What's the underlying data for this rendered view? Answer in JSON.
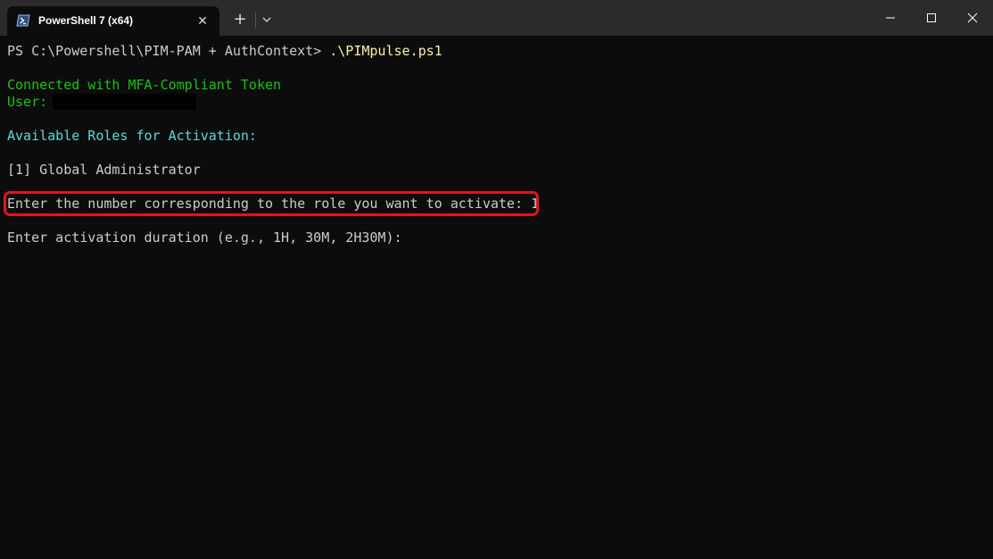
{
  "window": {
    "tab_title": "PowerShell 7 (x64)",
    "tab_icon": "powershell-icon",
    "new_tab_label": "+",
    "close_tab_label": "✕"
  },
  "terminal": {
    "prompt": "PS C:\\Powershell\\PIM-PAM + AuthContext> ",
    "command": ".\\PIMpulse.ps1",
    "connected": "Connected with MFA-Compliant Token",
    "user_label": "User:",
    "roles_header": "Available Roles for Activation:",
    "role_1": "[1] Global Administrator",
    "role_prompt": "Enter the number corresponding to the role you want to activate: 1",
    "duration_prompt": "Enter activation duration (e.g., 1H, 30M, 2H30M):"
  },
  "colors": {
    "background": "#0c0c0c",
    "titlebar": "#2b2b2b",
    "text": "#cccccc",
    "green": "#16c60c",
    "cyan": "#61d6d6",
    "yellow": "#f9f1a5",
    "highlight": "#e2141e"
  }
}
